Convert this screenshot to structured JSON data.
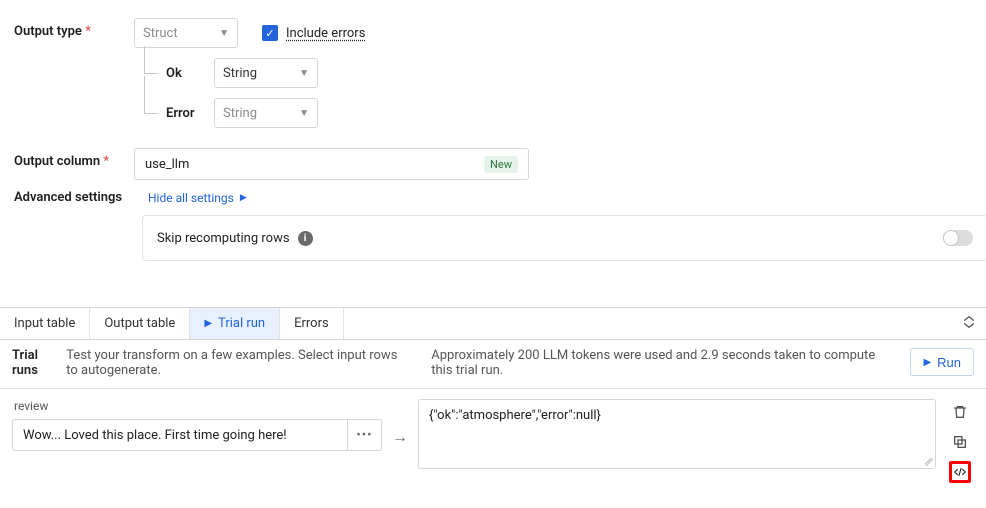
{
  "form": {
    "output_type_label": "Output type",
    "output_type_value": "Struct",
    "include_errors_label": "Include errors",
    "include_errors_checked": true,
    "children": {
      "ok_label": "Ok",
      "ok_type": "String",
      "error_label": "Error",
      "error_type": "String"
    },
    "output_column_label": "Output column",
    "output_column_value": "use_llm",
    "output_column_badge": "New"
  },
  "advanced": {
    "section_label": "Advanced settings",
    "hide_link": "Hide all settings",
    "skip_label": "Skip recomputing rows",
    "skip_enabled": false
  },
  "tabs": {
    "input": "Input table",
    "output": "Output table",
    "trial": "Trial run",
    "errors": "Errors"
  },
  "trial": {
    "title": "Trial runs",
    "desc": "Test your transform on a few examples. Select input rows to autogenerate.",
    "stats": "Approximately 200 LLM tokens were used and 2.9 seconds taken to compute this trial run.",
    "run_label": "Run",
    "input_header": "review",
    "input_value": "Wow... Loved this place. First time going here!",
    "result_value": "{\"ok\":\"atmosphere\",\"error\":null}"
  }
}
